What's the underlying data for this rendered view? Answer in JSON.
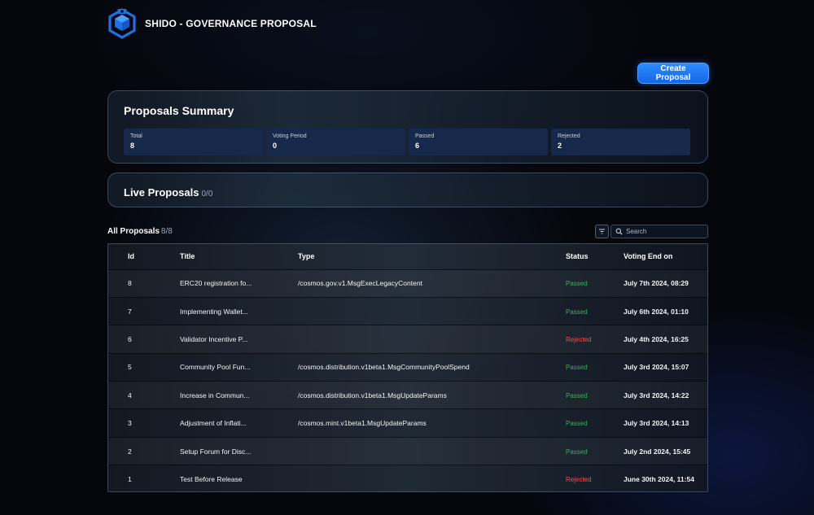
{
  "header": {
    "brand": "SHIDO - GOVERNANCE PROPOSAL",
    "logo_icon": "shido-cube-logo",
    "logo_color": "#1f6fe5"
  },
  "actions": {
    "create_label": "Create Proposal",
    "accent": "#2f8cff"
  },
  "summary": {
    "title": "Proposals Summary",
    "stats": [
      {
        "label": "Total",
        "value": "8"
      },
      {
        "label": "Voting Period",
        "value": "0"
      },
      {
        "label": "Passed",
        "value": "6"
      },
      {
        "label": "Rejected",
        "value": "2"
      }
    ]
  },
  "live": {
    "title": "Live Proposals",
    "count": "0/0"
  },
  "all": {
    "title": "All Proposals",
    "count": "8/8",
    "filter_icon": "filter-icon",
    "search_icon": "search-icon",
    "search_placeholder": "Search"
  },
  "table": {
    "columns": [
      "Id",
      "Title",
      "Type",
      "Status",
      "Voting End on"
    ],
    "rows": [
      {
        "id": "8",
        "title": "ERC20 registration fo...",
        "type": "/cosmos.gov.v1.MsgExecLegacyContent",
        "status": "Passed",
        "date": "July 7th 2024, 08:29"
      },
      {
        "id": "7",
        "title": "Implementing Wallet...",
        "type": "",
        "status": "Passed",
        "date": "July 6th 2024, 01:10"
      },
      {
        "id": "6",
        "title": "Validator Incentive P...",
        "type": "",
        "status": "Rejected",
        "date": "July 4th 2024, 16:25"
      },
      {
        "id": "5",
        "title": "Community Pool Fun...",
        "type": "/cosmos.distribution.v1beta1.MsgCommunityPoolSpend",
        "status": "Passed",
        "date": "July 3rd 2024, 15:07"
      },
      {
        "id": "4",
        "title": "Increase in Commun...",
        "type": "/cosmos.distribution.v1beta1.MsgUpdateParams",
        "status": "Passed",
        "date": "July 3rd 2024, 14:22"
      },
      {
        "id": "3",
        "title": "Adjustment of Inflati...",
        "type": "/cosmos.mint.v1beta1.MsgUpdateParams",
        "status": "Passed",
        "date": "July 3rd 2024, 14:13"
      },
      {
        "id": "2",
        "title": "Setup Forum for Disc...",
        "type": "",
        "status": "Passed",
        "date": "July 2nd 2024, 15:45"
      },
      {
        "id": "1",
        "title": "Test Before Release",
        "type": "",
        "status": "Rejected",
        "date": "June 30th 2024, 11:54"
      }
    ],
    "status_colors": {
      "Passed": "#36b35a",
      "Rejected": "#ff4a4a"
    }
  }
}
